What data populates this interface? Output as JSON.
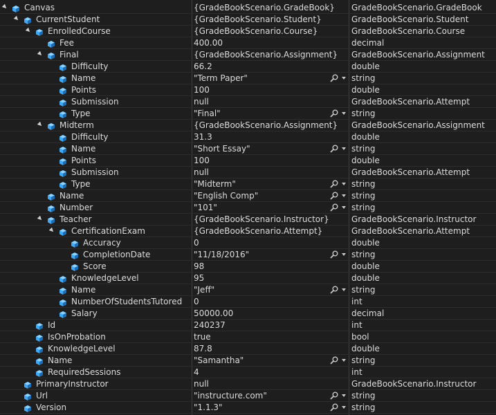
{
  "rows": [
    {
      "name": "Canvas",
      "value": "{GradeBookScenario.GradeBook}",
      "type": "GradeBookScenario.GradeBook",
      "expandable": true,
      "viz": false
    },
    {
      "name": "CurrentStudent",
      "value": "{GradeBookScenario.Student}",
      "type": "GradeBookScenario.Student",
      "expandable": true,
      "viz": false
    },
    {
      "name": "EnrolledCourse",
      "value": "{GradeBookScenario.Course}",
      "type": "GradeBookScenario.Course",
      "expandable": true,
      "viz": false
    },
    {
      "name": "Fee",
      "value": "400.00",
      "type": "decimal",
      "expandable": false,
      "viz": false
    },
    {
      "name": "Final",
      "value": "{GradeBookScenario.Assignment}",
      "type": "GradeBookScenario.Assignment",
      "expandable": true,
      "viz": false
    },
    {
      "name": "Difficulty",
      "value": "66.2",
      "type": "double",
      "expandable": false,
      "viz": false
    },
    {
      "name": "Name",
      "value": "\"Term Paper\"",
      "type": "string",
      "expandable": false,
      "viz": true
    },
    {
      "name": "Points",
      "value": "100",
      "type": "double",
      "expandable": false,
      "viz": false
    },
    {
      "name": "Submission",
      "value": "null",
      "type": "GradeBookScenario.Attempt",
      "expandable": false,
      "viz": false
    },
    {
      "name": "Type",
      "value": "\"Final\"",
      "type": "string",
      "expandable": false,
      "viz": true
    },
    {
      "name": "Midterm",
      "value": "{GradeBookScenario.Assignment}",
      "type": "GradeBookScenario.Assignment",
      "expandable": true,
      "viz": false
    },
    {
      "name": "Difficulty",
      "value": "31.3",
      "type": "double",
      "expandable": false,
      "viz": false
    },
    {
      "name": "Name",
      "value": "\"Short Essay\"",
      "type": "string",
      "expandable": false,
      "viz": true
    },
    {
      "name": "Points",
      "value": "100",
      "type": "double",
      "expandable": false,
      "viz": false
    },
    {
      "name": "Submission",
      "value": "null",
      "type": "GradeBookScenario.Attempt",
      "expandable": false,
      "viz": false
    },
    {
      "name": "Type",
      "value": "\"Midterm\"",
      "type": "string",
      "expandable": false,
      "viz": true
    },
    {
      "name": "Name",
      "value": "\"English Comp\"",
      "type": "string",
      "expandable": false,
      "viz": true
    },
    {
      "name": "Number",
      "value": "\"101\"",
      "type": "string",
      "expandable": false,
      "viz": true
    },
    {
      "name": "Teacher",
      "value": "{GradeBookScenario.Instructor}",
      "type": "GradeBookScenario.Instructor",
      "expandable": true,
      "viz": false
    },
    {
      "name": "CertificationExam",
      "value": "{GradeBookScenario.Attempt}",
      "type": "GradeBookScenario.Attempt",
      "expandable": true,
      "viz": false
    },
    {
      "name": "Accuracy",
      "value": "0",
      "type": "double",
      "expandable": false,
      "viz": false
    },
    {
      "name": "CompletionDate",
      "value": "\"11/18/2016\"",
      "type": "string",
      "expandable": false,
      "viz": true
    },
    {
      "name": "Score",
      "value": "98",
      "type": "double",
      "expandable": false,
      "viz": false
    },
    {
      "name": "KnowledgeLevel",
      "value": "95",
      "type": "double",
      "expandable": false,
      "viz": false
    },
    {
      "name": "Name",
      "value": "\"Jeff\"",
      "type": "string",
      "expandable": false,
      "viz": true
    },
    {
      "name": "NumberOfStudentsTutored",
      "value": "0",
      "type": "int",
      "expandable": false,
      "viz": false
    },
    {
      "name": "Salary",
      "value": "50000.00",
      "type": "decimal",
      "expandable": false,
      "viz": false
    },
    {
      "name": "Id",
      "value": "240237",
      "type": "int",
      "expandable": false,
      "viz": false
    },
    {
      "name": "IsOnProbation",
      "value": "true",
      "type": "bool",
      "expandable": false,
      "viz": false
    },
    {
      "name": "KnowledgeLevel",
      "value": "87.8",
      "type": "double",
      "expandable": false,
      "viz": false
    },
    {
      "name": "Name",
      "value": "\"Samantha\"",
      "type": "string",
      "expandable": false,
      "viz": true
    },
    {
      "name": "RequiredSessions",
      "value": "4",
      "type": "int",
      "expandable": false,
      "viz": false
    },
    {
      "name": "PrimaryInstructor",
      "value": "null",
      "type": "GradeBookScenario.Instructor",
      "expandable": false,
      "viz": false
    },
    {
      "name": "Url",
      "value": "\"instructure.com\"",
      "type": "string",
      "expandable": false,
      "viz": true
    },
    {
      "name": "Version",
      "value": "\"1.1.3\"",
      "type": "string",
      "expandable": false,
      "viz": true
    }
  ],
  "colors": {
    "background": "#1e1e1e",
    "text": "#dcdcdc",
    "cube_light": "#8fd3ff",
    "cube_mid": "#3fa9f5",
    "cube_dark": "#1b6fb8"
  },
  "icons": {
    "expand": "triangle-expanded-icon",
    "field": "field-cube-icon",
    "visualizer": "magnifier-icon",
    "visualizer_dropdown": "chevron-down-icon"
  }
}
